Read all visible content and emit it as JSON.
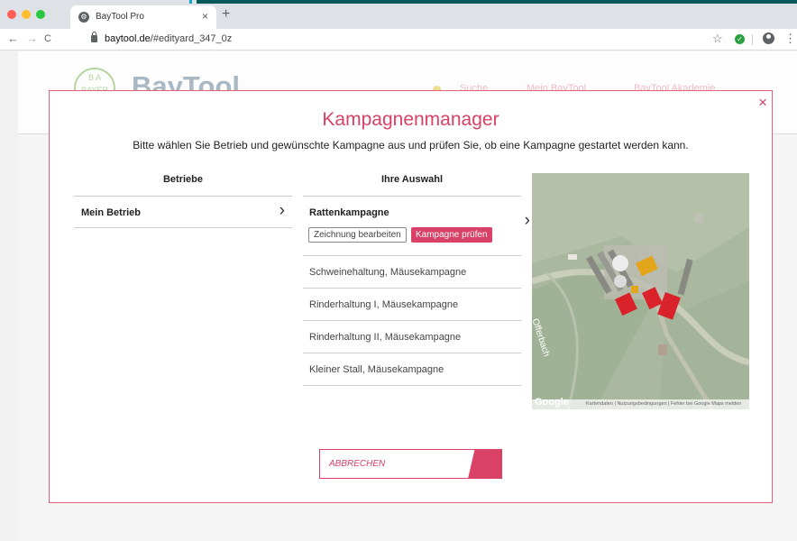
{
  "browser": {
    "tab_title": "BayTool Pro",
    "tab_close": "×",
    "new_tab": "+",
    "url_host": "baytool.de",
    "url_path": "/#edityard_347_0z",
    "back": "←",
    "forward": "→",
    "reload": "C",
    "star": "☆",
    "menu": "⋮",
    "traffic_colors": [
      "#ff5f57",
      "#febc2e",
      "#28c840"
    ]
  },
  "site": {
    "logo_text": "BayTool",
    "bayer_text": "B A BAYER",
    "nav": [
      "Suche",
      "Mein BayTool",
      "BayTool Akademie"
    ]
  },
  "modal": {
    "close": "×",
    "title": "Kampagnenmanager",
    "subtitle": "Bitte wählen Sie Betrieb und gewünschte Kampagne aus und prüfen Sie, ob eine Kampagne gestartet werden kann.",
    "col_farms": "Betriebe",
    "col_selection": "Ihre Auswahl",
    "farm": "Mein Betrieb",
    "chevron": "›",
    "active_campaign": "Rattenkampagne",
    "edit_button": "Zeichnung bearbeiten",
    "check_button": "Kampagne prüfen",
    "campaigns": [
      "Schweinehaltung, Mäusekampagne",
      "Rinderhaltung I, Mäusekampagne",
      "Rinderhaltung II, Mäusekampagne",
      "Kleiner Stall, Mäusekampagne"
    ],
    "cancel": "ABBRECHEN"
  },
  "map": {
    "street": "Offerbach",
    "google": "Google",
    "footer": "Kartendaten | Nutzungsbedingungen | Fehler bei Google Maps melden"
  },
  "colors": {
    "accent": "#d94166",
    "map_field": "#aab8a0",
    "roof_red": "#d9222a",
    "roof_yellow": "#e2a51c"
  }
}
